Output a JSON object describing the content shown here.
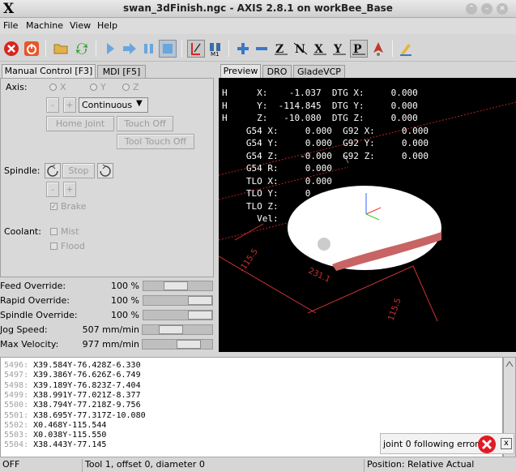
{
  "window": {
    "title": "swan_3dFinish.ngc - AXIS 2.8.1 on workBee_Base",
    "logo": "X"
  },
  "menu": [
    "File",
    "Machine",
    "View",
    "Help"
  ],
  "toolbar_icons": [
    "estop-icon",
    "power-icon",
    "open-icon",
    "reload-icon",
    "run-icon",
    "step-icon",
    "pause-icon",
    "stop-icon",
    "block-delete-icon",
    "optional-stop-icon",
    "zoom-in-icon",
    "zoom-out-icon",
    "view-z-icon",
    "view-z2-icon",
    "view-x-icon",
    "view-y-icon",
    "view-p-icon",
    "rotate-icon",
    "clear-plot-icon"
  ],
  "left_tabs": [
    "Manual Control [F3]",
    "MDI [F5]"
  ],
  "right_tabs": [
    "Preview",
    "DRO",
    "GladeVCP"
  ],
  "manual": {
    "axis_label": "Axis:",
    "axes": [
      "X",
      "Y",
      "Z"
    ],
    "minus": "-",
    "plus": "+",
    "jog_mode": "Continuous",
    "home_joint": "Home Joint",
    "touch_off": "Touch Off",
    "tool_touch_off": "Tool Touch Off",
    "spindle_label": "Spindle:",
    "stop": "Stop",
    "brake": "Brake",
    "coolant_label": "Coolant:",
    "mist": "Mist",
    "flood": "Flood"
  },
  "sliders": [
    {
      "label": "Feed Override:",
      "value": "100 %",
      "level": 0.45
    },
    {
      "label": "Rapid Override:",
      "value": "100 %",
      "level": 1.0
    },
    {
      "label": "Spindle Override:",
      "value": "100 %",
      "level": 1.0
    },
    {
      "label": "Jog Speed:",
      "value": "507 mm/min",
      "level": 0.35
    },
    {
      "label": "Max Velocity:",
      "value": "977 mm/min",
      "level": 0.75
    }
  ],
  "dro": {
    "rows": [
      {
        "flag": "H",
        "text": "     X:    -1.037  DTG X:     0.000"
      },
      {
        "flag": "H",
        "text": "     Y:  -114.845  DTG Y:     0.000"
      },
      {
        "flag": "H",
        "text": "     Z:   -10.080  DTG Z:     0.000"
      },
      {
        "flag": "",
        "text": "   G54 X:     0.000  G92 X:     0.000"
      },
      {
        "flag": "",
        "text": "   G54 Y:     0.000  G92 Y:     0.000"
      },
      {
        "flag": "",
        "text": "   G54 Z:    -0.000  G92 Z:     0.000"
      },
      {
        "flag": "",
        "text": "   G54 R:     0.000"
      },
      {
        "flag": "",
        "text": "   TLO X:     0.000"
      },
      {
        "flag": "",
        "text": "   TLO Y:     0"
      },
      {
        "flag": "",
        "text": "   TLO Z:"
      },
      {
        "flag": "",
        "text": "     Vel:"
      }
    ],
    "dim_labels": [
      "-115.5",
      "231.1",
      "115.5"
    ]
  },
  "gcode_lines": [
    {
      "num": "5496:",
      "code": "X39.584Y-76.428Z-6.330"
    },
    {
      "num": "5497:",
      "code": "X39.386Y-76.626Z-6.749"
    },
    {
      "num": "5498:",
      "code": "X39.189Y-76.823Z-7.404"
    },
    {
      "num": "5499:",
      "code": "X38.991Y-77.021Z-8.377"
    },
    {
      "num": "5500:",
      "code": "X38.794Y-77.218Z-9.756"
    },
    {
      "num": "5501:",
      "code": "X38.695Y-77.317Z-10.080"
    },
    {
      "num": "5502:",
      "code": "X0.468Y-115.544"
    },
    {
      "num": "5503:",
      "code": "X0.038Y-115.550"
    },
    {
      "num": "5504:",
      "code": "X38.443Y-77.145"
    }
  ],
  "error": {
    "message": "joint 0 following error",
    "close": "x"
  },
  "status": {
    "state": "OFF",
    "tool": "Tool 1, offset 0, diameter 0",
    "position": "Position: Relative Actual"
  },
  "colors": {
    "toolpath": "#c86464",
    "preview_bg": "#000000",
    "error": "#e01b24"
  }
}
